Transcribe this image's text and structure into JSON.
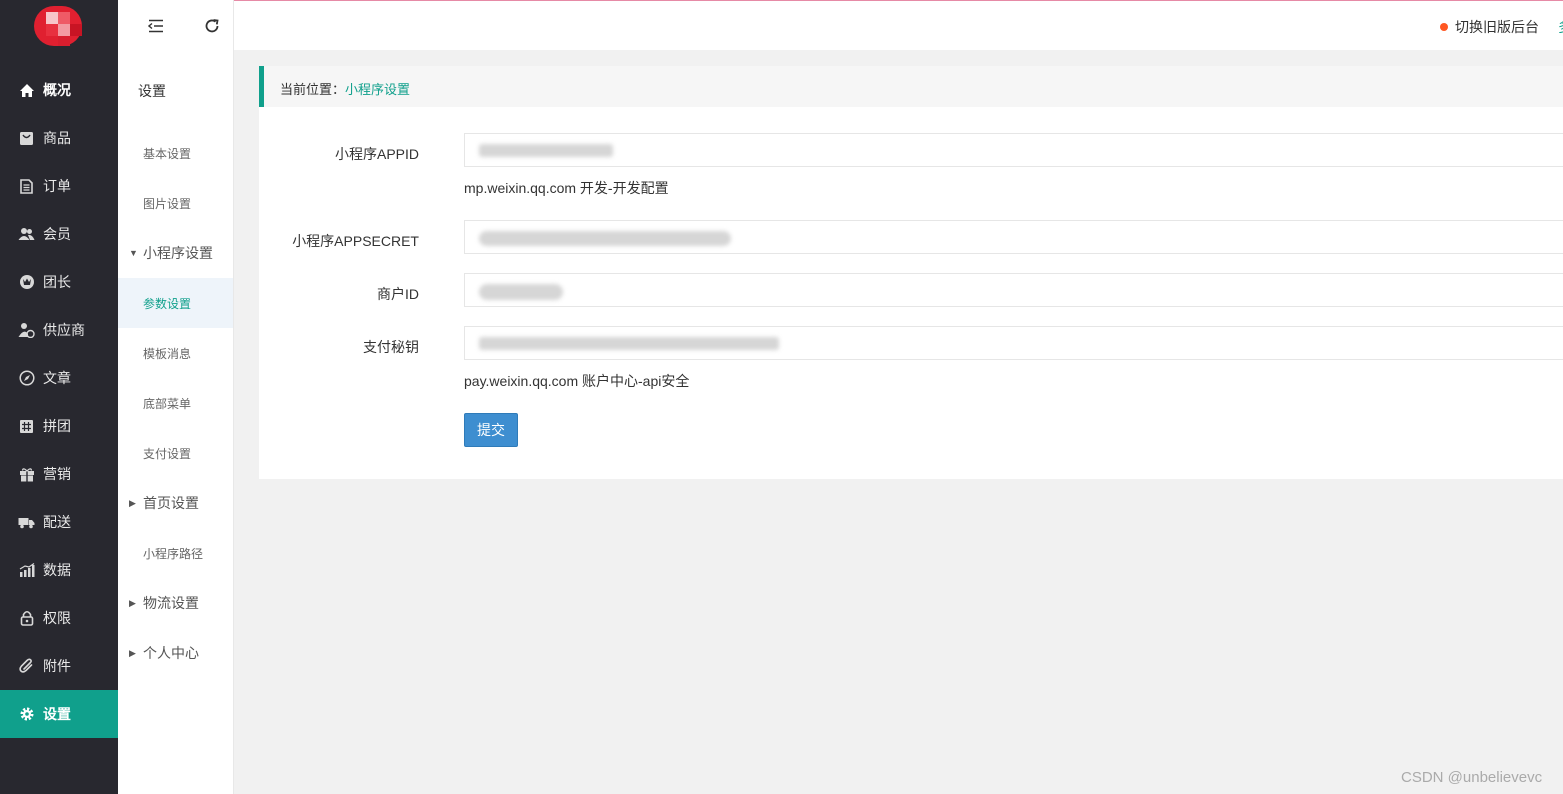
{
  "nav": {
    "items": [
      {
        "label": "概况",
        "icon": "home-icon"
      },
      {
        "label": "商品",
        "icon": "shopping-bag-icon"
      },
      {
        "label": "订单",
        "icon": "document-icon"
      },
      {
        "label": "会员",
        "icon": "users-icon"
      },
      {
        "label": "团长",
        "icon": "crown-icon"
      },
      {
        "label": "供应商",
        "icon": "supplier-icon"
      },
      {
        "label": "文章",
        "icon": "compass-icon"
      },
      {
        "label": "拼团",
        "icon": "grid-icon"
      },
      {
        "label": "营销",
        "icon": "gift-icon"
      },
      {
        "label": "配送",
        "icon": "truck-icon"
      },
      {
        "label": "数据",
        "icon": "chart-icon"
      },
      {
        "label": "权限",
        "icon": "lock-icon"
      },
      {
        "label": "附件",
        "icon": "paperclip-icon"
      },
      {
        "label": "设置",
        "icon": "gear-icon"
      }
    ],
    "active": "设置"
  },
  "subnav": {
    "title": "设置",
    "items": [
      {
        "label": "基本设置"
      },
      {
        "label": "图片设置"
      },
      {
        "label": "小程序设置",
        "group": true,
        "expanded": true
      },
      {
        "label": "参数设置",
        "active": true
      },
      {
        "label": "模板消息"
      },
      {
        "label": "底部菜单"
      },
      {
        "label": "支付设置"
      },
      {
        "label": "首页设置",
        "group": true,
        "expanded": false
      },
      {
        "label": "小程序路径"
      },
      {
        "label": "物流设置",
        "group": true,
        "expanded": false
      },
      {
        "label": "个人中心",
        "group": true,
        "expanded": false
      }
    ]
  },
  "header": {
    "switch_old": "切换旧版后台",
    "extra": "多"
  },
  "breadcrumb": {
    "prefix": "当前位置：",
    "current": "小程序设置"
  },
  "form": {
    "appid_label": "小程序APPID",
    "appid_hint": "mp.weixin.qq.com 开发-开发配置",
    "appsecret_label": "小程序APPSECRET",
    "mchid_label": "商户ID",
    "paykey_label": "支付秘钥",
    "paykey_hint": "pay.weixin.qq.com 账户中心-api安全",
    "submit_label": "提交"
  },
  "watermark": "CSDN @unbelievevc",
  "colors": {
    "sidebar_bg": "#28282f",
    "accent": "#10a08c",
    "submit_bg": "#3e8ed0",
    "dot": "#ff5722"
  }
}
